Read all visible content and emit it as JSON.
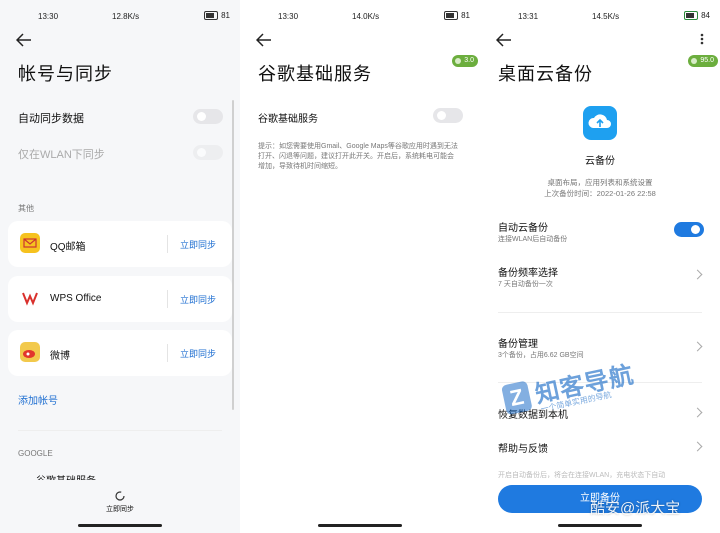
{
  "panel1": {
    "status": {
      "time": "13:30",
      "network": "12.8K/s",
      "battery": "81"
    },
    "title": "帐号与同步",
    "auto_sync_label": "自动同步数据",
    "wlan_only_label": "仅在WLAN下同步",
    "section_other": "其他",
    "accounts": [
      {
        "name": "QQ邮箱",
        "action": "立即同步",
        "icon": "qq-mail-icon"
      },
      {
        "name": "WPS Office",
        "action": "立即同步",
        "icon": "wps-icon"
      },
      {
        "name": "微博",
        "action": "立即同步",
        "icon": "weibo-icon"
      }
    ],
    "add_account": "添加帐号",
    "section_google": "GOOGLE",
    "google_item": "谷歌基础服务",
    "bottom_sync": "立即同步"
  },
  "panel2": {
    "status": {
      "time": "13:30",
      "network": "14.0K/s",
      "battery": "81"
    },
    "badge": "3.0",
    "title": "谷歌基础服务",
    "toggle_label": "谷歌基础服务",
    "hint": "提示：如您需要使用Gmail、Google Maps等谷歌应用时遇到无法打开、闪退等问题，建议打开此开关。开启后，系统耗电可能会增加，导致待机时间缩短。"
  },
  "panel3": {
    "status": {
      "time": "13:31",
      "network": "14.5K/s",
      "battery": "84"
    },
    "badge": "95.0",
    "title": "桌面云备份",
    "app_name": "云备份",
    "desc": "桌面布局，应用列表和系统设置",
    "last_backup": "上次备份时间：2022-01-26 22:58",
    "auto_backup_title": "自动云备份",
    "auto_backup_sub": "连接WLAN后自动备份",
    "freq_title": "备份频率选择",
    "freq_sub": "7 天自动备份一次",
    "manage_title": "备份管理",
    "manage_sub": "3个备份，占用6.62 GB空间",
    "restore_title": "恢复数据到本机",
    "help_title": "帮助与反馈",
    "bottom_fade_text": "开启自动备份后，将会在连接WLAN，充电状态下自动",
    "backup_button": "立即备份"
  },
  "watermark": {
    "logo_text": "知客导航",
    "logo_sub": "一个简单实用的导航",
    "credit": "酷安@派大宝"
  }
}
